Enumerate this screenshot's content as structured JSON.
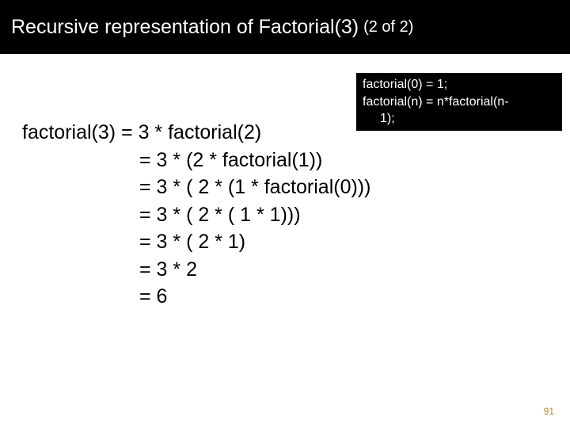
{
  "title": {
    "main": "Recursive representation of Factorial(3)",
    "suffix": "(2 of 2)"
  },
  "codebox": {
    "line1": "factorial(0) = 1;",
    "line2": "factorial(n) = n*factorial(n-",
    "line3": "1);"
  },
  "steps": {
    "l0": "factorial(3) = 3 * factorial(2)",
    "l1": "= 3 * (2 * factorial(1))",
    "l2": "= 3 * ( 2 * (1 * factorial(0)))",
    "l3": "= 3 * ( 2 * ( 1 * 1)))",
    "l4": "= 3 * ( 2 * 1)",
    "l5": "= 3 * 2",
    "l6": "= 6"
  },
  "page_number": "91"
}
